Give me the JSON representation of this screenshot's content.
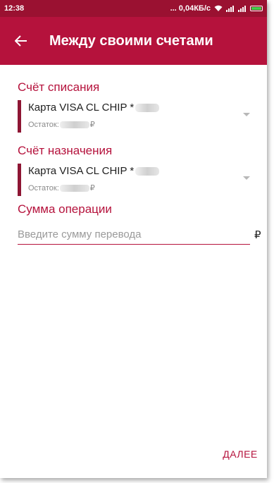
{
  "status_bar": {
    "time": "12:38",
    "network": "... 0,04КБ/с"
  },
  "header": {
    "title": "Между своими счетами"
  },
  "debit_account": {
    "label": "Счёт списания",
    "card_name": "Карта VISA CL CHIP *",
    "balance_label": "Остаток:",
    "currency_symbol": "₽"
  },
  "credit_account": {
    "label": "Счёт назначения",
    "card_name": "Карта VISA CL CHIP *",
    "balance_label": "Остаток:",
    "currency_symbol": "₽"
  },
  "amount": {
    "label": "Сумма операции",
    "placeholder": "Введите сумму перевода",
    "value": "",
    "currency_symbol": "₽"
  },
  "footer": {
    "next_label": "ДАЛЕЕ"
  },
  "colors": {
    "status_bar": "#9a1131",
    "app_bar": "#b5123c",
    "accent": "#b5123c",
    "account_marker": "#8e1634"
  },
  "icons": {
    "back": "arrow-left-icon",
    "wifi": "wifi-icon",
    "signal": "signal-icon",
    "battery": "battery-icon",
    "dropdown": "chevron-down-icon"
  }
}
